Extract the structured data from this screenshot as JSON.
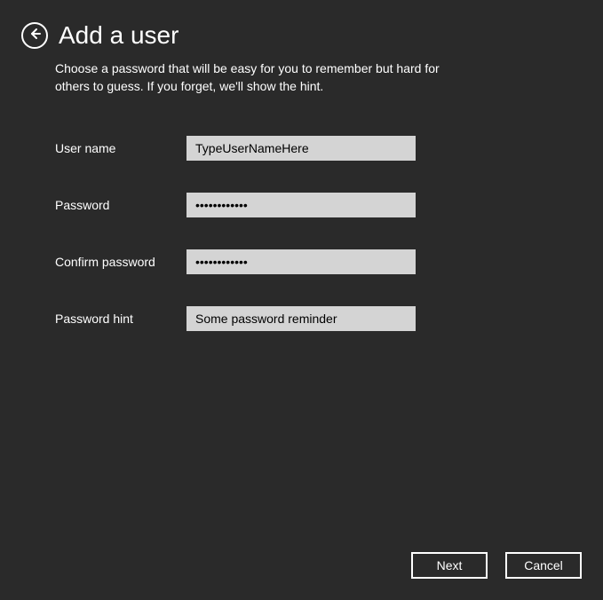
{
  "header": {
    "title": "Add a user"
  },
  "description": "Choose a password that will be easy for you to remember but hard for others to guess. If you forget, we'll show the hint.",
  "form": {
    "username": {
      "label": "User name",
      "value": "TypeUserNameHere"
    },
    "password": {
      "label": "Password",
      "value": "••••••••••••"
    },
    "confirm_password": {
      "label": "Confirm password",
      "value": "••••••••••••"
    },
    "password_hint": {
      "label": "Password hint",
      "value": "Some password reminder"
    }
  },
  "footer": {
    "next_label": "Next",
    "cancel_label": "Cancel"
  }
}
